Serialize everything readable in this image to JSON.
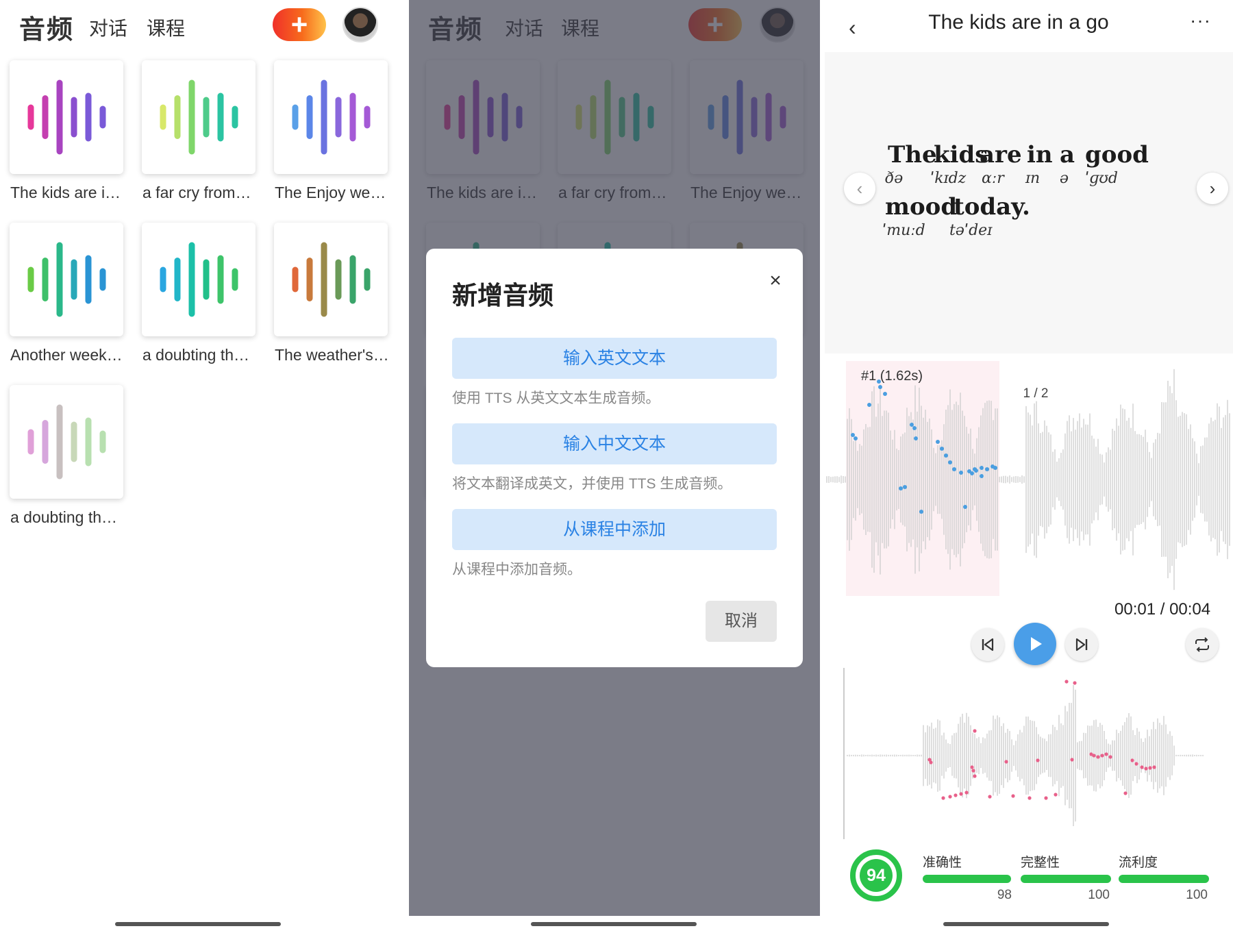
{
  "header": {
    "title": "音频",
    "tabs": [
      "对话",
      "课程"
    ],
    "add_label": "+"
  },
  "audio_list": [
    {
      "title": "The kids are i…",
      "colors": [
        "#e6389a",
        "#c43fb0",
        "#a844c0",
        "#8a4fcf",
        "#7a5ad8"
      ]
    },
    {
      "title": "a far cry from…",
      "colors": [
        "#d8e86a",
        "#b6e06a",
        "#7fd66a",
        "#4ecb8a",
        "#2bc4a2"
      ]
    },
    {
      "title": "The Enjoy we…",
      "colors": [
        "#5aa0e8",
        "#5b86e8",
        "#6a72e0",
        "#8a68dc",
        "#a45ad6"
      ]
    },
    {
      "title": "Another week…",
      "colors": [
        "#6acb46",
        "#3ec06a",
        "#2bb88a",
        "#28a8b8",
        "#2a94d4"
      ]
    },
    {
      "title": "a doubting th…",
      "colors": [
        "#2aa6e0",
        "#22b6c8",
        "#1cc0a8",
        "#22c08a",
        "#3ec46a"
      ]
    },
    {
      "title": "The weather's…",
      "colors": [
        "#e0683a",
        "#c87a3c",
        "#9a8a4a",
        "#6a9a58",
        "#3aa46a"
      ]
    },
    {
      "title": "a doubting th…",
      "colors": [
        "#e0a0d8",
        "#d6a6dc",
        "#c8c0c0",
        "#c8d8b8",
        "#b8e0b0"
      ]
    }
  ],
  "modal": {
    "title": "新增音频",
    "close": "×",
    "options": [
      {
        "button": "输入英文文本",
        "desc": "使用 TTS 从英文文本生成音频。"
      },
      {
        "button": "输入中文文本",
        "desc": "将文本翻译成英文，并使用 TTS 生成音频。"
      },
      {
        "button": "从课程中添加",
        "desc": "从课程中添加音频。"
      }
    ],
    "cancel": "取消"
  },
  "player": {
    "title": "The kids are in a go",
    "back": "‹",
    "more": "···",
    "prev": "‹",
    "next": "›",
    "words": [
      {
        "w": "The",
        "ipa": "ðə"
      },
      {
        "w": "kids",
        "ipa": "ˈkɪdz"
      },
      {
        "w": "are",
        "ipa": "ɑːr"
      },
      {
        "w": "in",
        "ipa": "ɪn"
      },
      {
        "w": "a",
        "ipa": "ə"
      },
      {
        "w": "good",
        "ipa": "ˈɡʊd"
      },
      {
        "w": "mood",
        "ipa": "ˈmuːd"
      },
      {
        "w": "today.",
        "ipa": "təˈdeɪ"
      }
    ],
    "page": "1 / 2",
    "segment_label": "#1 (1.62s)",
    "time": "00:01 / 00:04",
    "overall_score": "94",
    "metrics": [
      {
        "label": "准确性",
        "value": "98",
        "fraction": 0.98
      },
      {
        "label": "完整性",
        "value": "100",
        "fraction": 1.0
      },
      {
        "label": "流利度",
        "value": "100",
        "fraction": 1.0
      }
    ],
    "colors": {
      "accent": "#2a82e4",
      "score": "#2ac34a",
      "pitch_ref": "#4a9ee0",
      "pitch_user": "#e8608a",
      "segment_bg": "#fdf0f3"
    }
  }
}
